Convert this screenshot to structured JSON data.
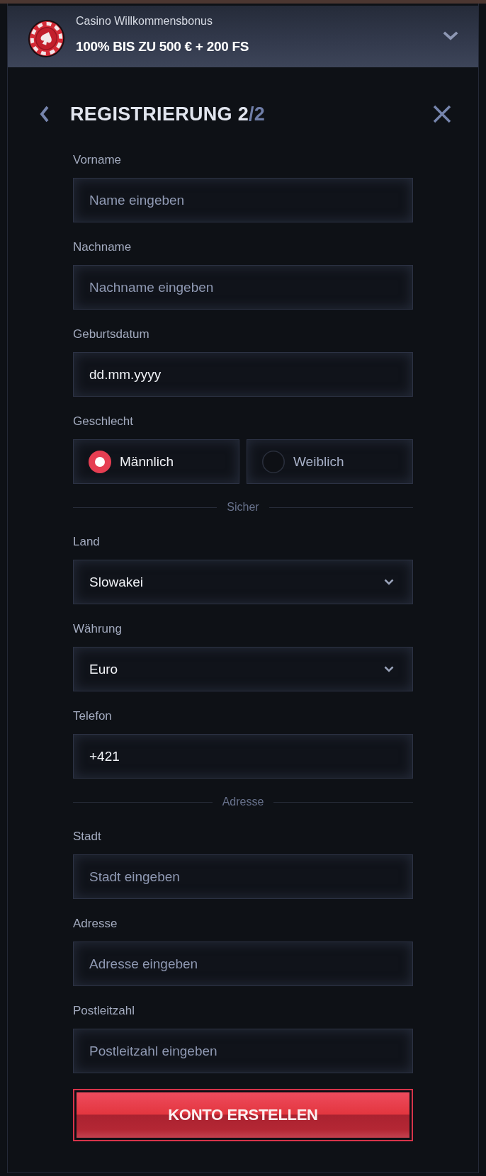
{
  "promo_banner": {
    "subtitle": "Casino Willkommensbonus",
    "title": "100% BIS ZU 500 € + 200 FS"
  },
  "header": {
    "title": "REGISTRIERUNG 2",
    "title_suffix": "/2"
  },
  "form": [
    {
      "kind": "input",
      "label": "Vorname",
      "placeholder": "Name eingeben"
    },
    {
      "kind": "input",
      "label": "Nachname",
      "placeholder": "Nachname eingeben"
    },
    {
      "kind": "input",
      "label": "Geburtsdatum",
      "value": "dd.mm.yyyy"
    },
    {
      "kind": "radio",
      "label": "Geschlecht",
      "options": [
        {
          "label": "Männlich",
          "selected": true
        },
        {
          "label": "Weiblich",
          "selected": false
        }
      ]
    },
    {
      "kind": "divider",
      "label": "Sicher"
    },
    {
      "kind": "select",
      "label": "Land",
      "value": "Slowakei"
    },
    {
      "kind": "select",
      "label": "Währung",
      "value": "Euro"
    },
    {
      "kind": "input",
      "label": "Telefon",
      "value": "+421"
    },
    {
      "kind": "divider",
      "label": "Adresse"
    },
    {
      "kind": "input",
      "label": "Stadt",
      "placeholder": "Stadt eingeben"
    },
    {
      "kind": "input",
      "label": "Adresse",
      "placeholder": "Adresse eingeben"
    },
    {
      "kind": "input",
      "label": "Postleitzahl",
      "placeholder": "Postleitzahl eingeben"
    }
  ],
  "submit_button": "KONTO ERSTELLEN"
}
